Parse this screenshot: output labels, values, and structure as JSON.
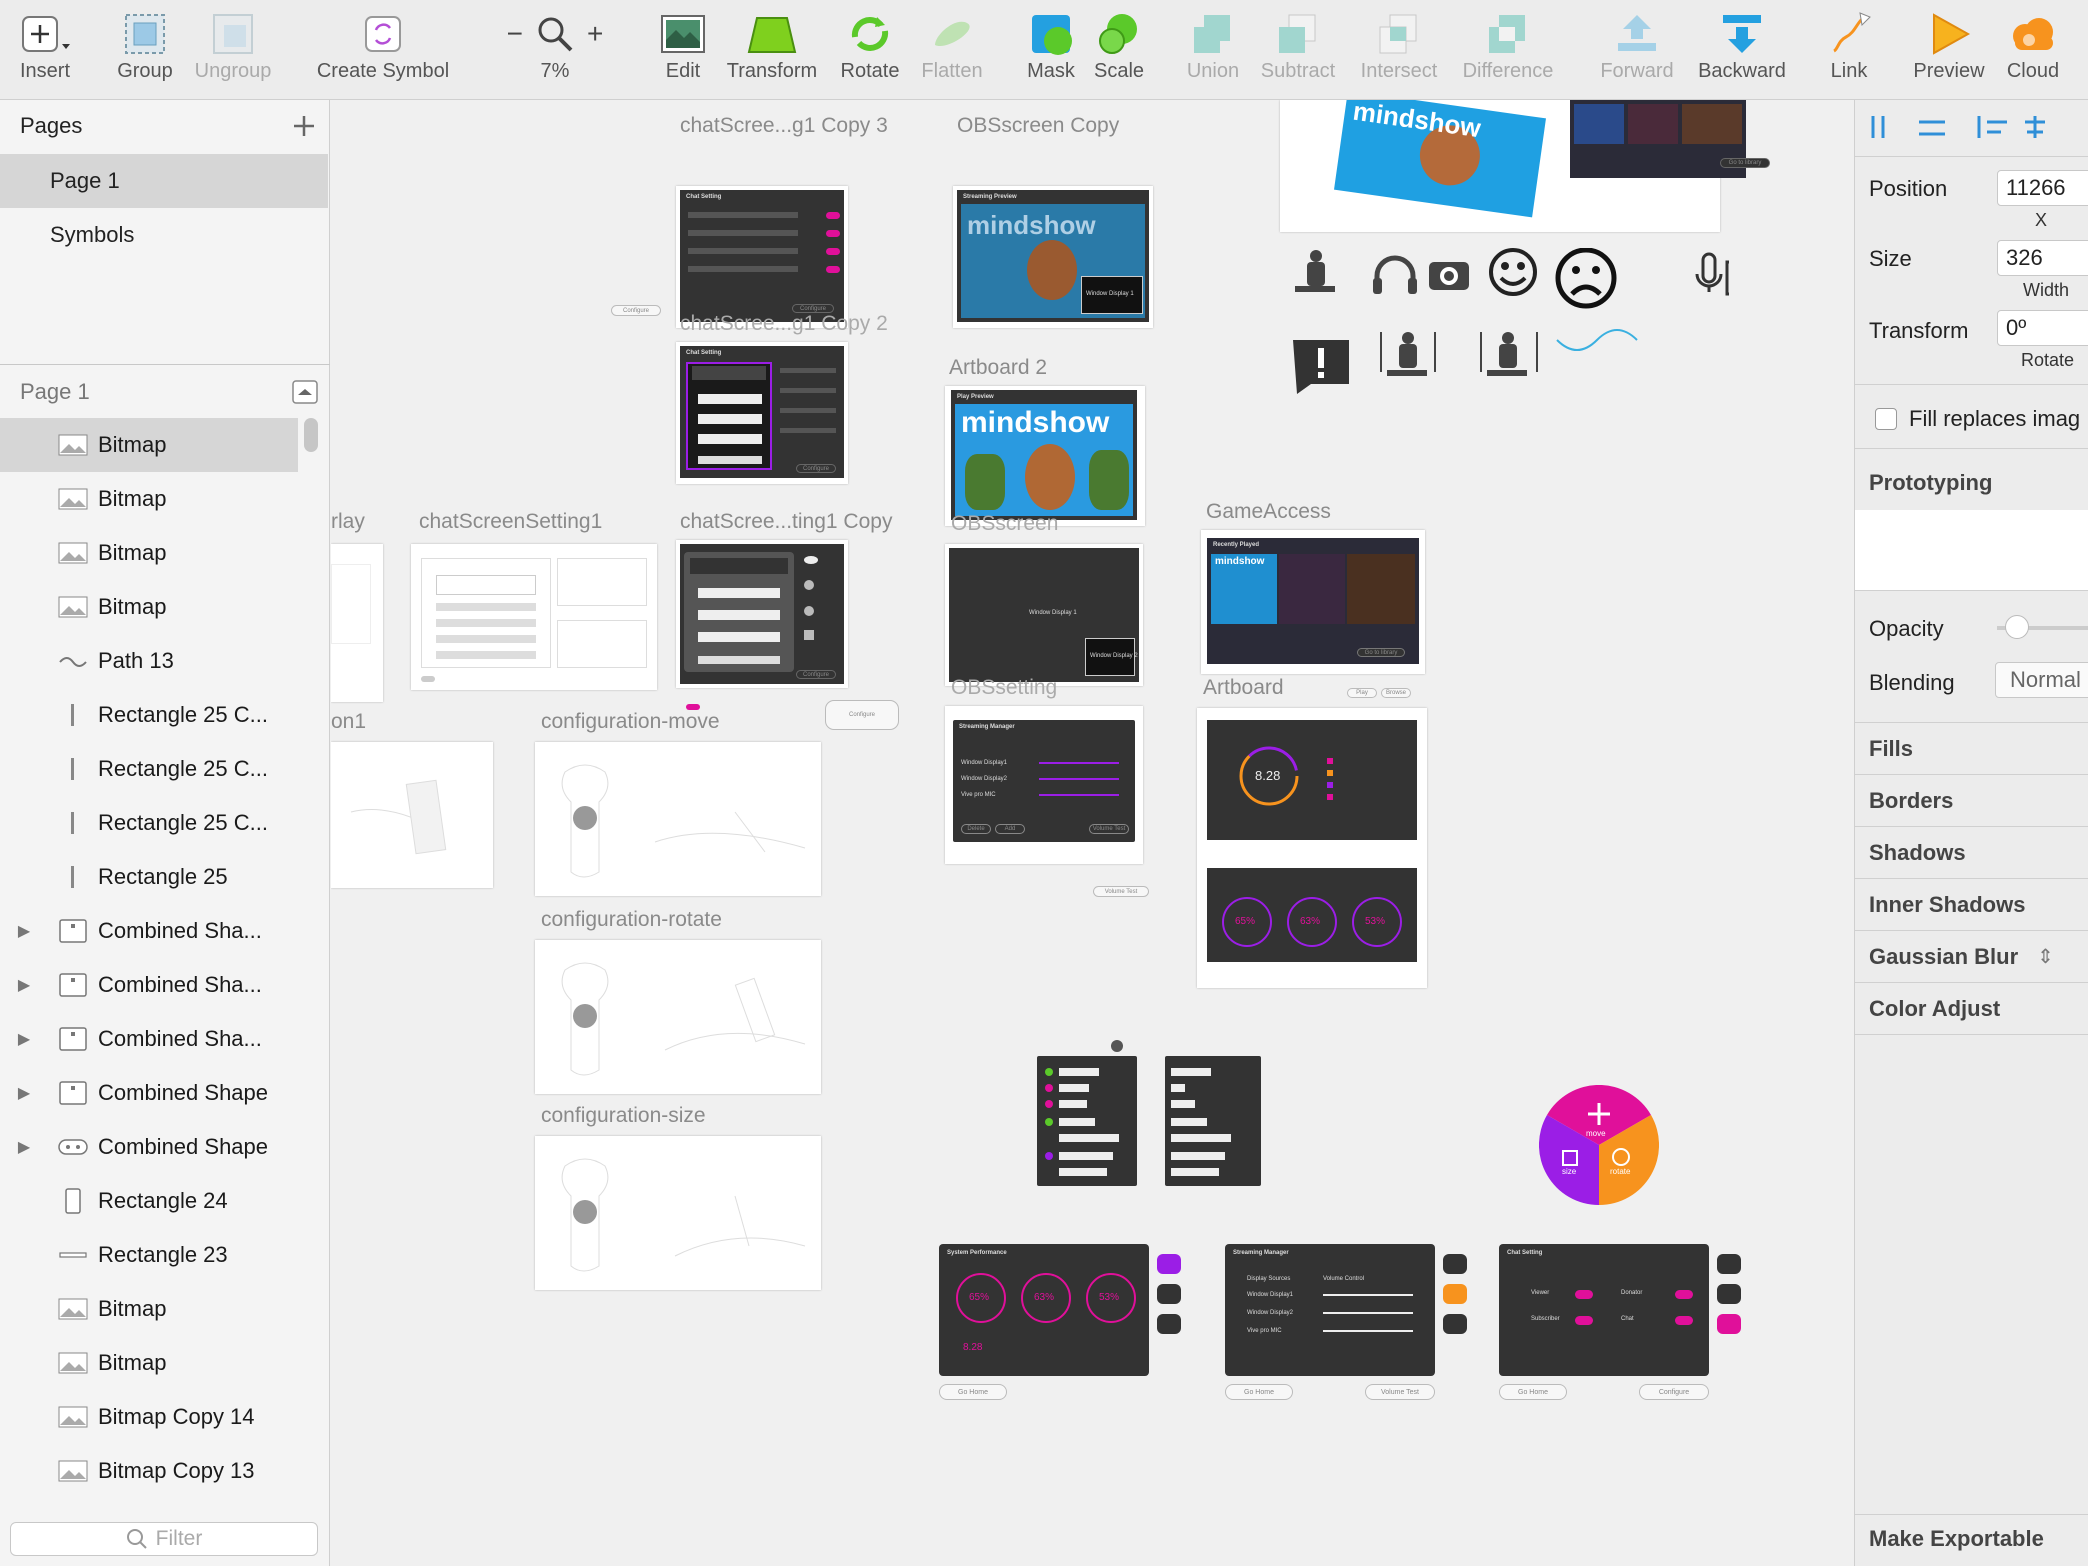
{
  "toolbar": {
    "items": [
      {
        "label": "Insert",
        "icon": "plus-icon"
      },
      {
        "label": "Group",
        "icon": "group-icon"
      },
      {
        "label": "Ungroup",
        "icon": "ungroup-icon"
      },
      {
        "label": "Create Symbol",
        "icon": "symbol-icon"
      },
      {
        "label": "7%",
        "icon": "zoom-icon",
        "minus": "−",
        "plus": "+"
      },
      {
        "label": "Edit",
        "icon": "edit-icon"
      },
      {
        "label": "Transform",
        "icon": "transform-icon"
      },
      {
        "label": "Rotate",
        "icon": "rotate-icon"
      },
      {
        "label": "Flatten",
        "icon": "flatten-icon"
      },
      {
        "label": "Mask",
        "icon": "mask-icon"
      },
      {
        "label": "Scale",
        "icon": "scale-icon"
      },
      {
        "label": "Union",
        "icon": "union-icon"
      },
      {
        "label": "Subtract",
        "icon": "subtract-icon"
      },
      {
        "label": "Intersect",
        "icon": "intersect-icon"
      },
      {
        "label": "Difference",
        "icon": "difference-icon"
      },
      {
        "label": "Forward",
        "icon": "forward-icon"
      },
      {
        "label": "Backward",
        "icon": "backward-icon"
      },
      {
        "label": "Link",
        "icon": "link-icon"
      },
      {
        "label": "Preview",
        "icon": "preview-icon"
      },
      {
        "label": "Cloud",
        "icon": "cloud-icon"
      }
    ]
  },
  "left": {
    "pages_title": "Pages",
    "add_icon": "plus-icon",
    "pages": [
      "Page 1",
      "Symbols"
    ],
    "layers_title": "Page 1",
    "layers": [
      {
        "name": "Bitmap",
        "type": "bitmap"
      },
      {
        "name": "Bitmap",
        "type": "bitmap"
      },
      {
        "name": "Bitmap",
        "type": "bitmap"
      },
      {
        "name": "Bitmap",
        "type": "bitmap"
      },
      {
        "name": "Path 13",
        "type": "path"
      },
      {
        "name": "Rectangle 25 C...",
        "type": "vline"
      },
      {
        "name": "Rectangle 25 C...",
        "type": "vline"
      },
      {
        "name": "Rectangle 25 C...",
        "type": "vline"
      },
      {
        "name": "Rectangle 25",
        "type": "vline"
      },
      {
        "name": "Combined Sha...",
        "type": "shape"
      },
      {
        "name": "Combined Sha...",
        "type": "shape"
      },
      {
        "name": "Combined Sha...",
        "type": "shape"
      },
      {
        "name": "Combined Shape",
        "type": "shape"
      },
      {
        "name": "Combined Shape",
        "type": "shape2"
      },
      {
        "name": "Rectangle 24",
        "type": "rect"
      },
      {
        "name": "Rectangle 23",
        "type": "hline"
      },
      {
        "name": "Bitmap",
        "type": "bitmap"
      },
      {
        "name": "Bitmap",
        "type": "bitmap"
      },
      {
        "name": "Bitmap Copy 14",
        "type": "bitmap"
      },
      {
        "name": "Bitmap Copy 13",
        "type": "bitmap"
      }
    ],
    "filter_placeholder": "Filter"
  },
  "canvas": {
    "artboards": [
      {
        "title": "chatScree...g1 Copy 3"
      },
      {
        "title": "OBSscreen Copy"
      },
      {
        "title": "chatScree...g1 Copy 2"
      },
      {
        "title": "Artboard 2"
      },
      {
        "title": "rlay"
      },
      {
        "title": "chatScreenSetting1"
      },
      {
        "title": "chatScree...ting1 Copy"
      },
      {
        "title": "OBSscreen"
      },
      {
        "title": "GameAccess"
      },
      {
        "title": "on1"
      },
      {
        "title": "configuration-move"
      },
      {
        "title": "OBSsetting"
      },
      {
        "title": "Artboard"
      },
      {
        "title": "configuration-rotate"
      },
      {
        "title": "configuration-size"
      }
    ],
    "brand": "mindshow",
    "chat_setting": "Chat Setting",
    "streaming_preview": "Streaming Preview",
    "play_preview": "Play Preview",
    "recently_played": "Recently Played",
    "streaming_manager": "Streaming Manager",
    "system_performance": "System Performance",
    "window_display_1": "Window Display 1",
    "window_display_2": "Window Display 2",
    "bandwidth": "8.28",
    "gauges": [
      "65%",
      "63%",
      "53%"
    ],
    "sources": [
      "Window Display1",
      "Window Display2",
      "Vive pro MIC"
    ],
    "display_sources": "Display Sources",
    "volume_control": "Volume Control",
    "chat_toggles": [
      "Viewer",
      "Donator",
      "Subscriber",
      "Chat"
    ],
    "radial": {
      "top": "move",
      "left": "size",
      "right": "rotate"
    },
    "buttons": {
      "go_home": "Go Home",
      "volume_test": "Volume Test",
      "configure": "Configure",
      "delete": "Delete",
      "add": "Add",
      "play": "Play",
      "browse": "Browse",
      "go_to_library": "Go to library"
    },
    "colors": {
      "magenta": "#e0109a",
      "orange": "#f7931e",
      "purple": "#9b1ee6",
      "dark": "#333333"
    }
  },
  "right": {
    "position_label": "Position",
    "position_value": "11266",
    "position_sub": "X",
    "size_label": "Size",
    "size_value": "326",
    "size_sub": "Width",
    "transform_label": "Transform",
    "transform_value": "0º",
    "transform_sub": "Rotate",
    "fill_replaces": "Fill replaces imag",
    "prototyping": "Prototyping",
    "opacity": "Opacity",
    "blending": "Blending",
    "blending_value": "Normal",
    "sections": [
      "Fills",
      "Borders",
      "Shadows",
      "Inner Shadows",
      "Gaussian Blur",
      "Color Adjust"
    ],
    "make_exportable": "Make Exportable"
  }
}
